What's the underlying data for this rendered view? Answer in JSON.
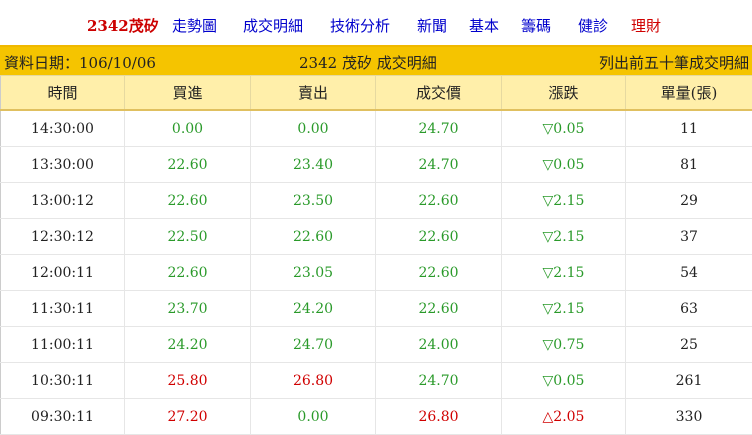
{
  "nav": {
    "stock": "2342茂矽",
    "links": [
      "走勢圖",
      "成交明細",
      "技術分析",
      "新聞",
      "基本",
      "籌碼",
      "健診",
      "理財"
    ]
  },
  "info": {
    "date_label": "資料日期：106/10/06",
    "title": "2342 茂矽 成交明細",
    "note": "列出前五十筆成交明細"
  },
  "table": {
    "headers": [
      "時間",
      "買進",
      "賣出",
      "成交價",
      "漲跌",
      "單量(張)"
    ],
    "rows": [
      {
        "time": "14:30:00",
        "bid": "0.00",
        "ask": "0.00",
        "price": "24.70",
        "change": "▽0.05",
        "vol": "11",
        "bid_color": "green",
        "ask_color": "green",
        "price_color": "green",
        "change_color": "green"
      },
      {
        "time": "13:30:00",
        "bid": "22.60",
        "ask": "23.40",
        "price": "24.70",
        "change": "▽0.05",
        "vol": "81",
        "bid_color": "green",
        "ask_color": "green",
        "price_color": "green",
        "change_color": "green"
      },
      {
        "time": "13:00:12",
        "bid": "22.60",
        "ask": "23.50",
        "price": "22.60",
        "change": "▽2.15",
        "vol": "29",
        "bid_color": "green",
        "ask_color": "green",
        "price_color": "green",
        "change_color": "green"
      },
      {
        "time": "12:30:12",
        "bid": "22.50",
        "ask": "22.60",
        "price": "22.60",
        "change": "▽2.15",
        "vol": "37",
        "bid_color": "green",
        "ask_color": "green",
        "price_color": "green",
        "change_color": "green"
      },
      {
        "time": "12:00:11",
        "bid": "22.60",
        "ask": "23.05",
        "price": "22.60",
        "change": "▽2.15",
        "vol": "54",
        "bid_color": "green",
        "ask_color": "green",
        "price_color": "green",
        "change_color": "green"
      },
      {
        "time": "11:30:11",
        "bid": "23.70",
        "ask": "24.20",
        "price": "22.60",
        "change": "▽2.15",
        "vol": "63",
        "bid_color": "green",
        "ask_color": "green",
        "price_color": "green",
        "change_color": "green"
      },
      {
        "time": "11:00:11",
        "bid": "24.20",
        "ask": "24.70",
        "price": "24.00",
        "change": "▽0.75",
        "vol": "25",
        "bid_color": "green",
        "ask_color": "green",
        "price_color": "green",
        "change_color": "green"
      },
      {
        "time": "10:30:11",
        "bid": "25.80",
        "ask": "26.80",
        "price": "24.70",
        "change": "▽0.05",
        "vol": "261",
        "bid_color": "red",
        "ask_color": "red",
        "price_color": "green",
        "change_color": "green"
      },
      {
        "time": "09:30:11",
        "bid": "27.20",
        "ask": "0.00",
        "price": "26.80",
        "change": "△2.05",
        "vol": "330",
        "bid_color": "red",
        "ask_color": "green",
        "price_color": "red",
        "change_color": "red"
      }
    ]
  },
  "colors": {
    "header_bar": "#f5c400",
    "table_header": "#ffefaa",
    "up": "#d00000",
    "down": "#2a9a2a",
    "link": "#0000cc"
  }
}
